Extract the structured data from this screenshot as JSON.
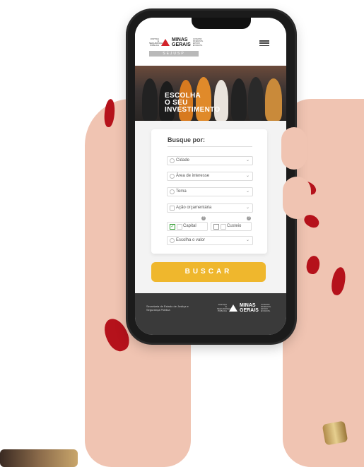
{
  "header": {
    "logo_small": "JUSTIÇA E SEGURANÇA PÚBLICA",
    "logo_name_line1": "MINAS",
    "logo_name_line2": "GERAIS",
    "logo_sub": "GOVERNO DIFERENTE. ESTADO EFICIENTE.",
    "org_badge": "SEJUSP"
  },
  "hero": {
    "line1": "ESCOLHA",
    "line2": "O SEU",
    "line3": "INVESTIMENTO"
  },
  "form": {
    "title": "Busque por:",
    "fields": [
      {
        "label": "Cidade"
      },
      {
        "label": "Área de interesse"
      },
      {
        "label": "Tema"
      },
      {
        "label": "Ação orçamentária"
      },
      {
        "label": "Escolha o valor"
      }
    ],
    "checkboxes": [
      {
        "label": "Capital",
        "checked": true
      },
      {
        "label": "Custeio",
        "checked": false
      }
    ],
    "submit_label": "BUSCAR"
  },
  "footer": {
    "text": "Secretaria de Estado de Justiça e Segurança Pública",
    "logo_small": "JUSTIÇA E SEGURANÇA PÚBLICA",
    "logo_name_line1": "MINAS",
    "logo_name_line2": "GERAIS",
    "logo_sub": "GOVERNO DIFERENTE. ESTADO EFICIENTE."
  },
  "colors": {
    "accent": "#efb72d",
    "brand_red": "#d2232a",
    "footer_bg": "#3a3a3a",
    "nail": "#b5121b"
  }
}
